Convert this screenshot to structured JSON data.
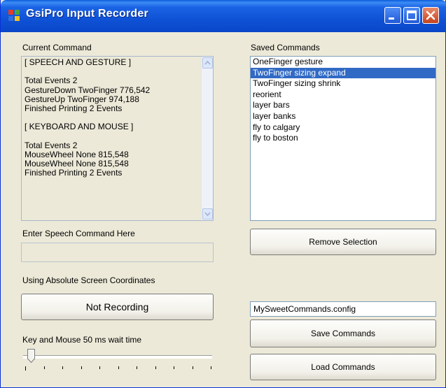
{
  "window": {
    "title": "GsiPro Input Recorder"
  },
  "current_command": {
    "label": "Current Command",
    "lines": [
      "[ SPEECH AND GESTURE ]",
      "",
      "Total Events 2",
      "GestureDown TwoFinger 776,542",
      "GestureUp TwoFinger 974,188",
      "Finished Printing 2 Events",
      "",
      "[ KEYBOARD AND MOUSE ]",
      "",
      "Total Events 2",
      "MouseWheel None 815,548",
      "MouseWheel None 815,548",
      "Finished Printing 2 Events"
    ]
  },
  "saved_commands": {
    "label": "Saved Commands",
    "items": [
      "OneFinger gesture",
      "TwoFinger sizing expand",
      "TwoFinger sizing shrink",
      "reorient",
      "layer bars",
      "layer banks",
      "fly to calgary",
      "fly to boston"
    ],
    "selected_index": 1
  },
  "speech": {
    "label": "Enter Speech Command Here",
    "value": ""
  },
  "remove_button": "Remove Selection",
  "coordinates_label": "Using Absolute Screen Coordinates",
  "record_button": "Not Recording",
  "config_file": "MySweetCommands.config",
  "save_button": "Save Commands",
  "load_button": "Load Commands",
  "wait": {
    "label": "Key and Mouse 50 ms wait time",
    "slider_value": 50
  },
  "colors": {
    "selection": "#316ac5",
    "titlebar": "#0a5ddb",
    "background": "#ece9d8"
  }
}
